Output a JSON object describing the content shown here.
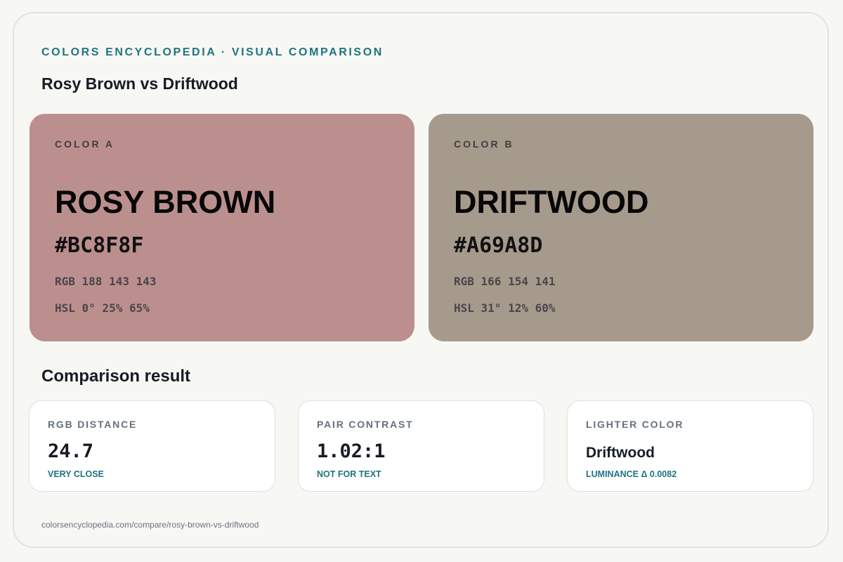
{
  "header": {
    "eyebrow": "COLORS ENCYCLOPEDIA · VISUAL COMPARISON",
    "title": "Rosy Brown vs Driftwood"
  },
  "colors": [
    {
      "label": "COLOR A",
      "name": "ROSY BROWN",
      "hex": "#BC8F8F",
      "rgb": "RGB 188 143 143",
      "hsl": "HSL 0° 25% 65%",
      "swatch_color": "#BC8F8F"
    },
    {
      "label": "COLOR B",
      "name": "DRIFTWOOD",
      "hex": "#A69A8D",
      "rgb": "RGB 166 154 141",
      "hsl": "HSL 31° 12% 60%",
      "swatch_color": "#A69A8D"
    }
  ],
  "comparison": {
    "title": "Comparison result",
    "cards": [
      {
        "label": "RGB DISTANCE",
        "value": "24.7",
        "note": "VERY CLOSE"
      },
      {
        "label": "PAIR CONTRAST",
        "value": "1.02:1",
        "note": "NOT FOR TEXT"
      },
      {
        "label": "LIGHTER COLOR",
        "value": "Driftwood",
        "note": "LUMINANCE Δ 0.0082"
      }
    ]
  },
  "footer": {
    "url": "colorsencyclopedia.com/compare/rosy-brown-vs-driftwood"
  },
  "theme": {
    "accent": "#1f7382",
    "text_dark": "#161b26",
    "background": "#f7f7f3"
  }
}
